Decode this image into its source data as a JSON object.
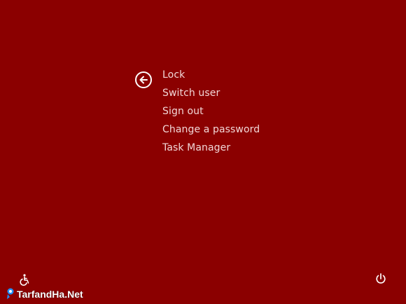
{
  "screen": {
    "background_color": "#8b0000"
  },
  "back": {
    "icon": "back-arrow-icon"
  },
  "menu": {
    "items": [
      {
        "label": "Lock"
      },
      {
        "label": "Switch user"
      },
      {
        "label": "Sign out"
      },
      {
        "label": "Change a password"
      },
      {
        "label": "Task Manager"
      }
    ]
  },
  "footer": {
    "ease_of_access_icon": "ease-of-access-icon",
    "power_icon": "power-icon"
  },
  "watermark": {
    "text": "TarfandHa.Net",
    "logo_color": "#1e90ff"
  }
}
